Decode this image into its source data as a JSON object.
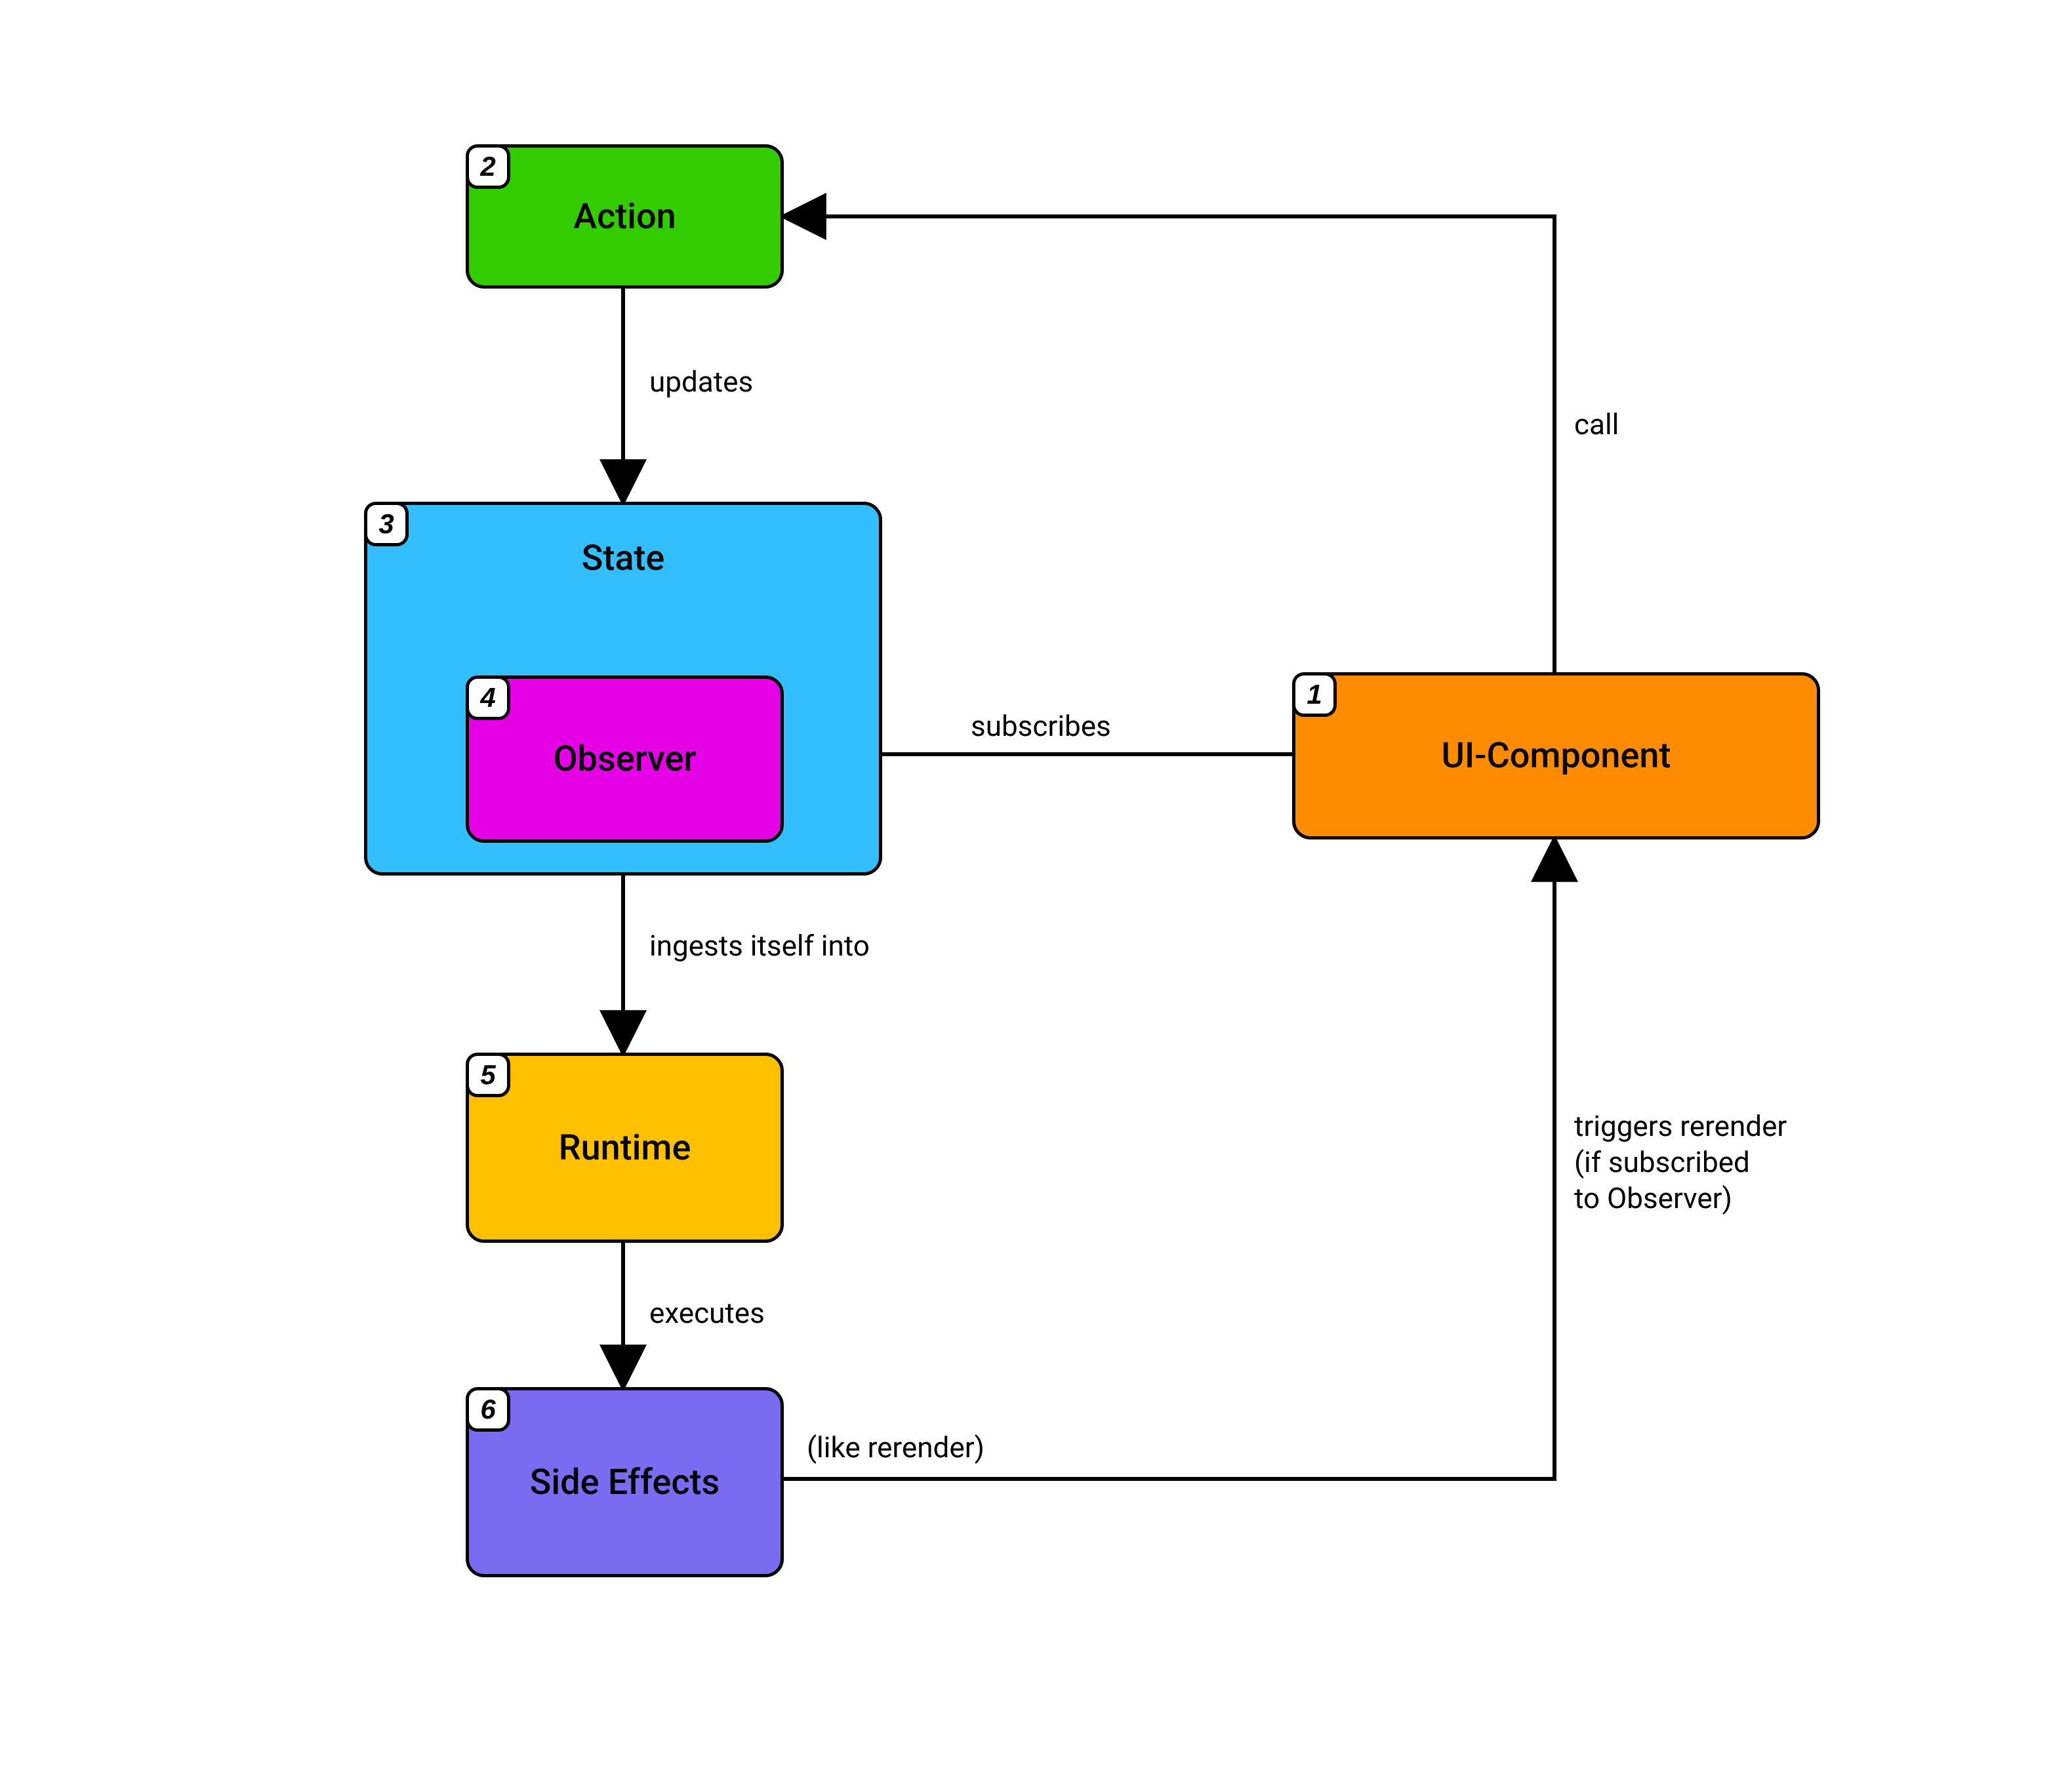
{
  "nodes": {
    "ui_component": {
      "badge": "1",
      "label": "UI-Component",
      "color": "#ff8c00"
    },
    "action": {
      "badge": "2",
      "label": "Action",
      "color": "#33cc00"
    },
    "state": {
      "badge": "3",
      "label": "State",
      "color": "#33bfff"
    },
    "observer": {
      "badge": "4",
      "label": "Observer",
      "color": "#e500e5"
    },
    "runtime": {
      "badge": "5",
      "label": "Runtime",
      "color": "#ffc000"
    },
    "side_effects": {
      "badge": "6",
      "label": "Side Effects",
      "color": "#7a6cf0"
    }
  },
  "edges": {
    "call": "call",
    "updates": "updates",
    "subscribes": "subscribes",
    "ingests": "ingests itself into",
    "executes": "executes",
    "like_rerender": "(like rerender)",
    "triggers": "triggers rerender\n(if subscribed\nto Observer)"
  }
}
